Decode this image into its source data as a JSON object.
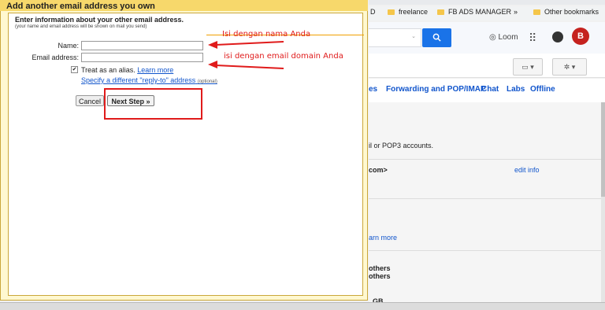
{
  "browser": {
    "bookmarks": [
      {
        "label": "D",
        "folder": false
      },
      {
        "label": "freelance",
        "folder": true
      },
      {
        "label": "FB ADS MANAGER",
        "folder": true
      },
      {
        "label": "»",
        "folder": false
      },
      {
        "label": "Other bookmarks",
        "folder": true
      }
    ]
  },
  "gmail": {
    "search_icon": "search-icon",
    "loom_label": "Loom",
    "avatar_initial": "B",
    "tabs": [
      "es",
      "Forwarding and POP/IMAP",
      "Chat",
      "Labs",
      "Offline"
    ],
    "content": {
      "pop3_text": "il or POP3 accounts.",
      "address_text": "com>",
      "edit_info": "edit info",
      "learn_more": "arn more",
      "others1": "others",
      "others2": "others",
      "storage": "GB."
    },
    "accent": "#1a73e8"
  },
  "dialog": {
    "title": "Add another email address you own",
    "heading": "Enter information about your other email address.",
    "subheading": "(your name and email address will be shown on mail you send)",
    "name_label": "Name:",
    "email_label": "Email address:",
    "name_value": "",
    "email_value": "",
    "alias_text": "Treat as an alias.",
    "alias_checked": true,
    "learn_more": "Learn more",
    "reply_to_link": "Specify a different \"reply-to\" address",
    "optional": "(optional)",
    "cancel_label": "Cancel",
    "next_label": "Next Step »"
  },
  "annotations": {
    "name_hint": "Isi dengan nama Anda",
    "email_hint": "isi dengan email domain Anda",
    "color": "#e01b1b"
  }
}
